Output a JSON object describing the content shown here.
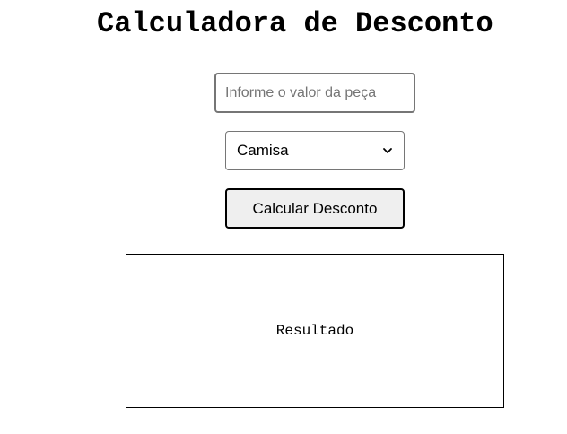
{
  "header": {
    "title": "Calculadora de Desconto"
  },
  "form": {
    "price_placeholder": "Informe o valor da peça",
    "price_value": "",
    "product_selected": "Camisa",
    "calculate_label": "Calcular Desconto"
  },
  "result": {
    "text": "Resultado"
  },
  "icons": {
    "select_arrow": "chevron-down-icon"
  }
}
